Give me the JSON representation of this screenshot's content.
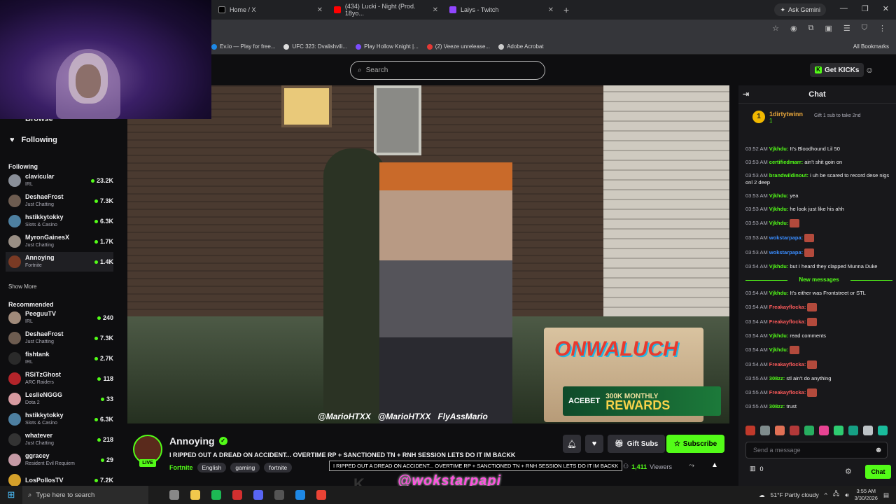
{
  "browser": {
    "tabs": [
      {
        "label": "Home / X",
        "color": "#000000"
      },
      {
        "label": "(434) Lucki - Night (Prod. 18yo...",
        "color": "#ff0000"
      },
      {
        "label": "Laiys - Twitch",
        "color": "#9146ff"
      }
    ],
    "new_tab": "+",
    "gemini": "Ask Gemini",
    "bookmarks": [
      {
        "label": "Ev.io — Play for free...",
        "color": "#1e88e5"
      },
      {
        "label": "UFC 323: Dvalishvili...",
        "color": "#dddddd"
      },
      {
        "label": "Play Hollow Knight |...",
        "color": "#7c4dff"
      },
      {
        "label": "(2) Veeze unrelease...",
        "color": "#e53935"
      },
      {
        "label": "Adobe Acrobat",
        "color": "#cccccc"
      }
    ],
    "all_bookmarks": "All Bookmarks"
  },
  "topnav": {
    "search_placeholder": "Search",
    "get_kicks": "Get KICKs"
  },
  "sidebar": {
    "browse": "Browse",
    "following_nav": "Following",
    "following_header": "Following",
    "following": [
      {
        "name": "clavicular",
        "category": "IRL",
        "viewers": "23.2K",
        "color": "#8a8f99"
      },
      {
        "name": "DeshaeFrost",
        "category": "Just Chatting",
        "viewers": "7.3K",
        "color": "#6d5c50"
      },
      {
        "name": "hstikkytokky",
        "category": "Slots & Casino",
        "viewers": "6.3K",
        "color": "#4d7fa0"
      },
      {
        "name": "MyronGainesX",
        "category": "Just Chatting",
        "viewers": "1.7K",
        "color": "#9a8f85"
      },
      {
        "name": "Annoying",
        "category": "Fortnite",
        "viewers": "1.4K",
        "color": "#7a3a24"
      }
    ],
    "show_more": "Show More",
    "recommended_header": "Recommended",
    "recommended": [
      {
        "name": "PeeguuTV",
        "category": "IRL",
        "viewers": "240",
        "color": "#a08a7a"
      },
      {
        "name": "DeshaeFrost",
        "category": "Just Chatting",
        "viewers": "7.3K",
        "color": "#6d5c50"
      },
      {
        "name": "fishtank",
        "category": "IRL",
        "viewers": "2.7K",
        "color": "#2a2a2a"
      },
      {
        "name": "RSiTzGhost",
        "category": "ARC Raiders",
        "viewers": "118",
        "color": "#b3242a"
      },
      {
        "name": "LeslieNGGG",
        "category": "Dota 2",
        "viewers": "33",
        "color": "#d79aa0"
      },
      {
        "name": "hstikkytokky",
        "category": "Slots & Casino",
        "viewers": "6.3K",
        "color": "#4d7fa0"
      },
      {
        "name": "whatever",
        "category": "Just Chatting",
        "viewers": "218",
        "color": "#333333"
      },
      {
        "name": "ggracey",
        "category": "Resident Evil Requiem",
        "viewers": "29",
        "color": "#c59aa5"
      },
      {
        "name": "LosPollosTV",
        "category": "",
        "viewers": "7.2K",
        "color": "#d4a02a"
      }
    ]
  },
  "video": {
    "socials": [
      "@MarioHTXX",
      "@MarioHTXX",
      "FlyAssMario"
    ],
    "overlay_logo": "ONWALUCH",
    "acebet_brand": "ACEBET",
    "acebet_line1": "300K MONTHLY",
    "acebet_line2": "REWARDS"
  },
  "stream": {
    "streamer": "Annoying",
    "live": "LIVE",
    "title": "I RIPPED OUT A DREAD ON ACCIDENT... OVERTIME RP + SANCTIONED TN + RNH SESSION LETS DO IT IM BACKK",
    "category": "Fortnite",
    "tags": [
      "English",
      "gaming",
      "fortnite"
    ],
    "tooltip": "I RIPPED OUT A DREAD ON ACCIDENT... OVERTIME RP + SANCTIONED TN + RNH SESSION LETS DO IT IM BACKK",
    "gift_subs": "Gift Subs",
    "subscribe": "Subscribe",
    "viewers": "1,411",
    "viewers_label": "Viewers"
  },
  "chat": {
    "title": "Chat",
    "pinned": {
      "rank": "1",
      "name": "1dirtytwinn",
      "count": "1",
      "text": "Gift 1 sub to take 2nd"
    },
    "messages": [
      {
        "time": "03:52 AM",
        "user": "Vjkhdu:",
        "color": "#53fc18",
        "text": "It's Bloodhound Lil 50"
      },
      {
        "time": "03:53 AM",
        "user": "certifiedmarr:",
        "color": "#53fc18",
        "text": "ain't shit goin on"
      },
      {
        "time": "03:53 AM",
        "user": "brandwildinout:",
        "color": "#53fc18",
        "text": "i uh be scared to record dese nigs onl 2 deep"
      },
      {
        "time": "03:53 AM",
        "user": "Vjkhdu:",
        "color": "#53fc18",
        "text": "yea"
      },
      {
        "time": "03:53 AM",
        "user": "Vjkhdu:",
        "color": "#53fc18",
        "text": "he look just like his ahh"
      },
      {
        "time": "03:53 AM",
        "user": "Vjkhdu:",
        "color": "#53fc18",
        "text": "",
        "emote": true
      },
      {
        "time": "03:53 AM",
        "user": "wokstarpapa:",
        "color": "#3a8dff",
        "text": "",
        "emote": true
      },
      {
        "time": "03:53 AM",
        "user": "wokstarpapa:",
        "color": "#3a8dff",
        "text": "",
        "emote": true
      },
      {
        "time": "03:54 AM",
        "user": "Vjkhdu:",
        "color": "#53fc18",
        "text": "but I heard they clapped Munna Duke"
      }
    ],
    "new_messages": "New messages",
    "new": [
      {
        "time": "03:54 AM",
        "user": "Vjkhdu:",
        "color": "#53fc18",
        "text": "It's either was Frontstreet or STL"
      },
      {
        "time": "03:54 AM",
        "user": "Freakayflocka:",
        "color": "#ff5b5b",
        "text": "",
        "emote": true
      },
      {
        "time": "03:54 AM",
        "user": "Freakayflocka:",
        "color": "#ff5b5b",
        "text": "",
        "emote": true
      },
      {
        "time": "03:54 AM",
        "user": "Vjkhdu:",
        "color": "#53fc18",
        "text": "read comments"
      },
      {
        "time": "03:54 AM",
        "user": "Vjkhdu:",
        "color": "#53fc18",
        "text": "",
        "emote": true
      },
      {
        "time": "03:54 AM",
        "user": "Freakayflocka:",
        "color": "#ff5b5b",
        "text": "",
        "emote": true
      },
      {
        "time": "03:55 AM",
        "user": "308zz:",
        "color": "#53fc18",
        "text": "stl ain't do anything"
      },
      {
        "time": "03:55 AM",
        "user": "Freakayflocka:",
        "color": "#ff5b5b",
        "text": "",
        "emote": true
      },
      {
        "time": "03:55 AM",
        "user": "308zz:",
        "color": "#53fc18",
        "text": "trust"
      }
    ],
    "input_placeholder": "Send a message",
    "points": "0",
    "chat_button": "Chat",
    "emote_colors": [
      "#c0392b",
      "#7f8c8d",
      "#e17055",
      "#b33939",
      "#27ae60",
      "#e84393",
      "#2ecc71",
      "#16a085",
      "#bdc3c7",
      "#1abc9c"
    ]
  },
  "overlays": {
    "username": "@wokstarpapi",
    "kick_mark": "K"
  },
  "taskbar": {
    "search_placeholder": "Type here to search",
    "weather": "51°F  Partly cloudy",
    "time": "3:55 AM",
    "date": "3/30/2026",
    "icon_colors": [
      "#888888",
      "#f2c94c",
      "#1db954",
      "#d32f2f",
      "#5865f2",
      "#555555",
      "#1e88e5",
      "#ea4335"
    ]
  }
}
